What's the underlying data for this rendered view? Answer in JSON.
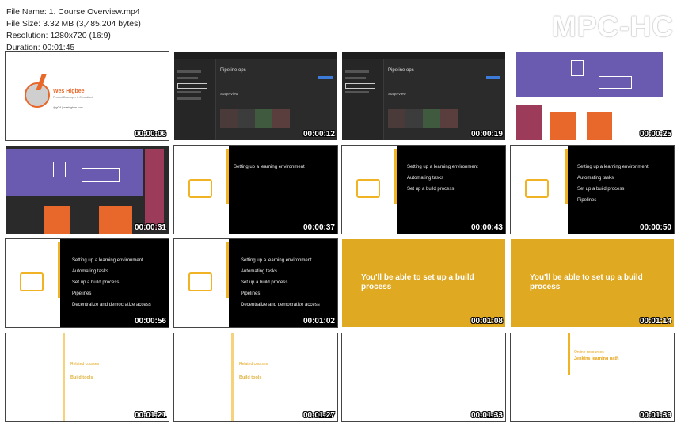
{
  "file_info": {
    "name": "File Name: 1. Course Overview.mp4",
    "size": "File Size: 3.32 MB (3,485,204 bytes)",
    "resolution": "Resolution: 1280x720 (16:9)",
    "duration": "Duration: 00:01:45"
  },
  "logo": "MPC-HC",
  "thumbs": {
    "t1": {
      "time": "00:00:06",
      "author": "Wes Higbee",
      "subtitle": "Product Developer & Consultant",
      "handle": "@g0t4  |  weshigbee.com"
    },
    "t2": {
      "time": "00:00:12",
      "heading": "Pipeline ops",
      "stage": "Stage View"
    },
    "t3": {
      "time": "00:00:19",
      "heading": "Pipeline ops",
      "stage": "Stage View"
    },
    "t4": {
      "time": "00:00:25"
    },
    "t5": {
      "time": "00:00:31"
    },
    "t6": {
      "time": "00:00:37",
      "b1": "Setting up a learning environment"
    },
    "t7": {
      "time": "00:00:43",
      "b1": "Setting up a learning environment",
      "b2": "Automating tasks",
      "b3": "Set up a build process"
    },
    "t8": {
      "time": "00:00:50",
      "b1": "Setting up a learning environment",
      "b2": "Automating tasks",
      "b3": "Set up a build process",
      "b4": "Pipelines"
    },
    "t9": {
      "time": "00:00:56",
      "b1": "Setting up a learning environment",
      "b2": "Automating tasks",
      "b3": "Set up a build process",
      "b4": "Pipelines",
      "b5": "Decentralize and democratize access"
    },
    "t10": {
      "time": "00:01:02",
      "b1": "Setting up a learning environment",
      "b2": "Automating tasks",
      "b3": "Set up a build process",
      "b4": "Pipelines",
      "b5": "Decentralize and democratize access"
    },
    "t11": {
      "time": "00:01:08",
      "text": "You'll be able to set up a build process"
    },
    "t12": {
      "time": "00:01:14",
      "text": "You'll be able to set up a build process"
    },
    "t13": {
      "time": "00:01:21",
      "kicker": "Related courses",
      "title": "Build tools"
    },
    "t14": {
      "time": "00:01:27",
      "kicker": "Related courses",
      "title": "Build tools"
    },
    "t15": {
      "time": "00:01:33"
    },
    "t16": {
      "time": "00:01:39",
      "kicker": "Online resources",
      "title": "Jenkins learning path"
    }
  },
  "colors": {
    "accent_gold": "#e0a922",
    "purple": "#6a5ab0",
    "orange": "#e8672a",
    "maroon": "#9c3b5a"
  }
}
